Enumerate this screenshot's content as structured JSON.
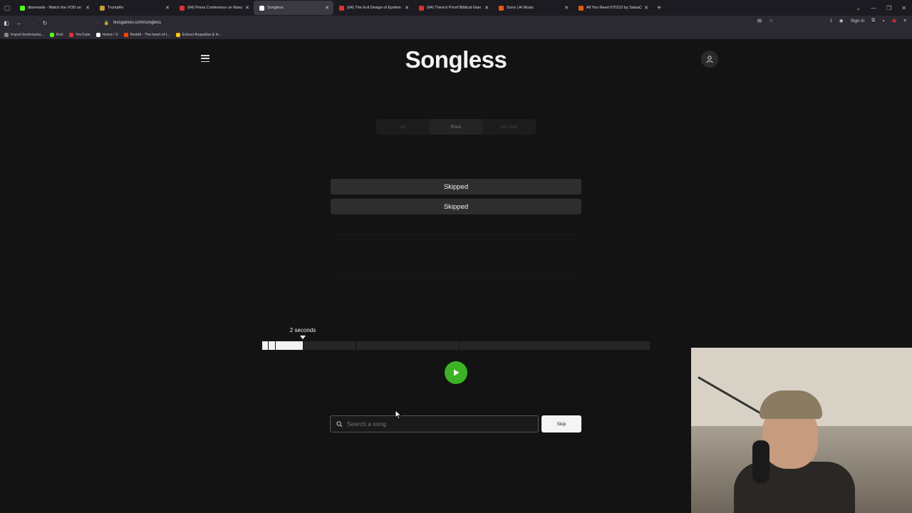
{
  "browser": {
    "tabs": [
      {
        "label": "dtanmanb - Watch the VOD on",
        "color": "#53fc18"
      },
      {
        "label": "TrumpRx",
        "color": "#c89b3c"
      },
      {
        "label": "(64) Press Conference on Nanc",
        "color": "#e03131"
      },
      {
        "label": "Songless",
        "color": "#ffffff",
        "active": true
      },
      {
        "label": "(64) The Evil Design of Epstein",
        "color": "#e03131"
      },
      {
        "label": "(64) There's Proof Biblical Gian",
        "color": "#e03131"
      },
      {
        "label": "Suno | AI Music",
        "color": "#e8590c"
      },
      {
        "label": "All You Need 070210 by SalsaC",
        "color": "#e8590c"
      }
    ],
    "url": "lessgames.com/songless",
    "sign_in": "Sign in",
    "bookmarks": [
      {
        "label": "Import bookmarks...",
        "color": "#888"
      },
      {
        "label": "Kick",
        "color": "#53fc18"
      },
      {
        "label": "YouTube",
        "color": "#e03131"
      },
      {
        "label": "Home / X",
        "color": "#ffffff"
      },
      {
        "label": "Reddit - The heart of t...",
        "color": "#ff4500"
      },
      {
        "label": "Extract Acapellas & In...",
        "color": "#fcc419"
      }
    ]
  },
  "app": {
    "title": "Songless",
    "genres": [
      "All",
      "Rock",
      "Hip Hop"
    ],
    "active_genre": "Rock",
    "guesses": [
      "Skipped",
      "Skipped",
      "",
      "",
      "",
      ""
    ],
    "seconds_label": "2 seconds",
    "progress_fraction": 0.105,
    "search_placeholder": "Search a song",
    "skip_label": "Skip"
  }
}
